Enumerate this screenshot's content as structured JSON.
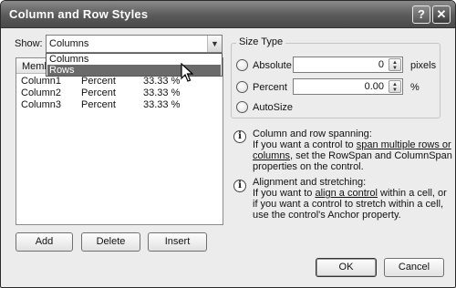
{
  "window": {
    "title": "Column and Row Styles",
    "help_glyph": "?",
    "close_glyph": "✕"
  },
  "show": {
    "label": "Show:",
    "selected": "Columns",
    "options": [
      "Columns",
      "Rows"
    ],
    "highlighted_option": "Rows"
  },
  "grid": {
    "header_partial": "Memb",
    "rows": [
      {
        "member": "Column1",
        "type": "Percent",
        "value": "33.33 %"
      },
      {
        "member": "Column2",
        "type": "Percent",
        "value": "33.33 %"
      },
      {
        "member": "Column3",
        "type": "Percent",
        "value": "33.33 %"
      }
    ]
  },
  "buttons": {
    "add": "Add",
    "delete": "Delete",
    "insert": "Insert",
    "ok": "OK",
    "cancel": "Cancel"
  },
  "size_type": {
    "group_label": "Size Type",
    "absolute": {
      "label": "Absolute",
      "value": "0",
      "unit": "pixels"
    },
    "percent": {
      "label": "Percent",
      "value": "0.00",
      "unit": "%"
    },
    "autosize": {
      "label": "AutoSize"
    }
  },
  "info": {
    "spanning": {
      "line1": "Column and row spanning:",
      "line2_pre": "If you want a control to ",
      "line2_link": "span multiple rows or",
      "line3_link": "columns",
      "line3_post": ", set the RowSpan and ColumnSpan",
      "line4": "properties on the control."
    },
    "alignment": {
      "line1": "Alignment and stretching:",
      "line2_pre": "If you want to ",
      "line2_link": "align a control",
      "line2_post": " within a cell, or",
      "line3": "if you want a control to stretch within a cell,",
      "line4": "use the control's Anchor property."
    }
  }
}
